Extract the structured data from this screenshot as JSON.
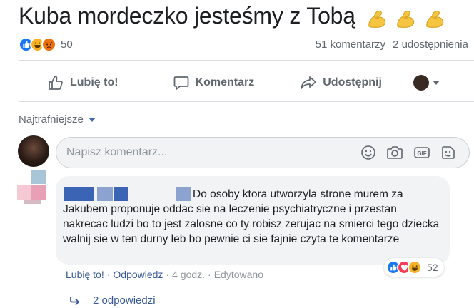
{
  "post": {
    "text": "Kuba mordeczko jesteśmy z Tobą",
    "emoji_icons": [
      "flexed-biceps-icon",
      "flexed-biceps-icon",
      "flexed-biceps-icon"
    ]
  },
  "stats": {
    "reaction_icons": [
      "like-reaction-icon",
      "haha-reaction-icon",
      "angry-reaction-icon"
    ],
    "reaction_count": "50",
    "comments": "51 komentarzy",
    "shares": "2 udostępnienia"
  },
  "actions": {
    "like": "Lubię to!",
    "comment": "Komentarz",
    "share": "Udostępnij"
  },
  "sort": {
    "label": "Najtrafniejsze"
  },
  "comment_input": {
    "placeholder": "Napisz komentarz..."
  },
  "comment": {
    "text": "Do osoby ktora utworzyla strone murem za Jakubem proponuje oddac sie na leczenie psychiatryczne i przestan nakrecac ludzi bo to jest zalosne co ty robisz zerujac na smierci tego dziecka walnij sie w ten durny leb bo pewnie ci sie fajnie czyta te komentarze",
    "reaction_count": "52",
    "reaction_icons": [
      "like-reaction-icon",
      "love-reaction-icon",
      "haha-reaction-icon"
    ],
    "meta": {
      "like": "Lubię to!",
      "reply": "Odpowiedz",
      "time": "4 godz.",
      "edited": "Edytowano"
    }
  },
  "replies": {
    "label": "2 odpowiedzi"
  },
  "colors": {
    "link": "#385898",
    "like_blue": "#1877f2",
    "censor_blue": "#3b64b5",
    "bubble_bg": "#f2f3f5"
  }
}
